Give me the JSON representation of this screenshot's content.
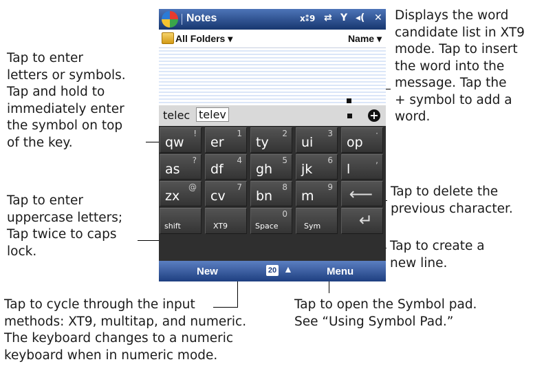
{
  "phone": {
    "title": "Notes",
    "status_icons": [
      "xt9-indicator-icon",
      "sync-icon",
      "signal-icon",
      "volume-icon",
      "close-icon"
    ],
    "status_glyphs": {
      "xt9": "x⁑9",
      "sync": "⇄",
      "signal": "Y",
      "volume": "◂(",
      "close": "✕"
    },
    "folder_label": "All Folders ▾",
    "sort_label": "Name ▾",
    "candidates": [
      "telec",
      "telev"
    ],
    "add_word_symbol": "+",
    "keys": [
      [
        {
          "label": "qw",
          "sym": "!"
        },
        {
          "label": "er",
          "sym": "1"
        },
        {
          "label": "ty",
          "sym": "2"
        },
        {
          "label": "ui",
          "sym": "3"
        },
        {
          "label": "op",
          "sym": "·"
        }
      ],
      [
        {
          "label": "as",
          "sym": "?"
        },
        {
          "label": "df",
          "sym": "4"
        },
        {
          "label": "gh",
          "sym": "5"
        },
        {
          "label": "jk",
          "sym": "6"
        },
        {
          "label": "l",
          "sym": ","
        }
      ],
      [
        {
          "label": "zx",
          "sym": "@"
        },
        {
          "label": "cv",
          "sym": "7"
        },
        {
          "label": "bn",
          "sym": "8"
        },
        {
          "label": "m",
          "sym": "9"
        },
        {
          "label": "",
          "sym": "",
          "icon": "backspace-arrow-icon",
          "glyph": "⟵"
        }
      ],
      [
        {
          "label": "shift",
          "sym": ""
        },
        {
          "label": "XT9",
          "sym": ""
        },
        {
          "label": "Space",
          "sym": "0"
        },
        {
          "label": "Sym",
          "sym": ""
        },
        {
          "label": "",
          "sym": "",
          "icon": "enter-arrow-icon",
          "glyph": "↵"
        }
      ]
    ],
    "menu": {
      "left": "New",
      "center_badge": "20",
      "center_caret": "▲",
      "right": "Menu"
    }
  },
  "callouts": {
    "letters_symbols": [
      "Tap to enter",
      "letters or symbols.",
      "Tap and hold to",
      "immediately enter",
      "the symbol on top",
      "of the key."
    ],
    "uppercase": [
      "Tap to enter",
      "uppercase letters;",
      "Tap twice to caps",
      "lock."
    ],
    "input_methods": [
      "Tap to cycle through the input",
      "methods: XT9, multitap, and numeric.",
      "The keyboard changes to a numeric",
      "keyboard when in numeric mode."
    ],
    "word_candidates": [
      "Displays the word",
      "candidate list in XT9",
      "mode. Tap to insert",
      "the word into the",
      "message. Tap the",
      "+ symbol to add a",
      "word."
    ],
    "delete": [
      "Tap to delete the",
      "previous character."
    ],
    "new_line": [
      "Tap to create a",
      "new line."
    ],
    "symbol_pad": [
      "Tap to open the Symbol pad.",
      "See “Using Symbol Pad.”"
    ]
  }
}
